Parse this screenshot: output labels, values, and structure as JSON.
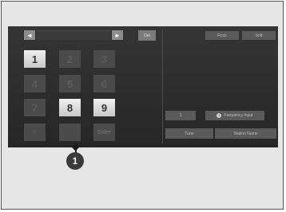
{
  "screen": {
    "prev_arrow": "◄",
    "next_arrow": "►",
    "delete_label": "Del",
    "top_buttons": [
      "Rock",
      "Soft"
    ],
    "keypad": [
      "1",
      "2",
      "3",
      "4",
      "5",
      "6",
      "7",
      "8",
      "9",
      "0",
      "",
      "Enter"
    ],
    "lower_left_button": "1",
    "info_button_label": "Frequency Input",
    "bottom_buttons": [
      "Tune",
      "Station Name"
    ]
  },
  "callout": {
    "number": "1"
  }
}
